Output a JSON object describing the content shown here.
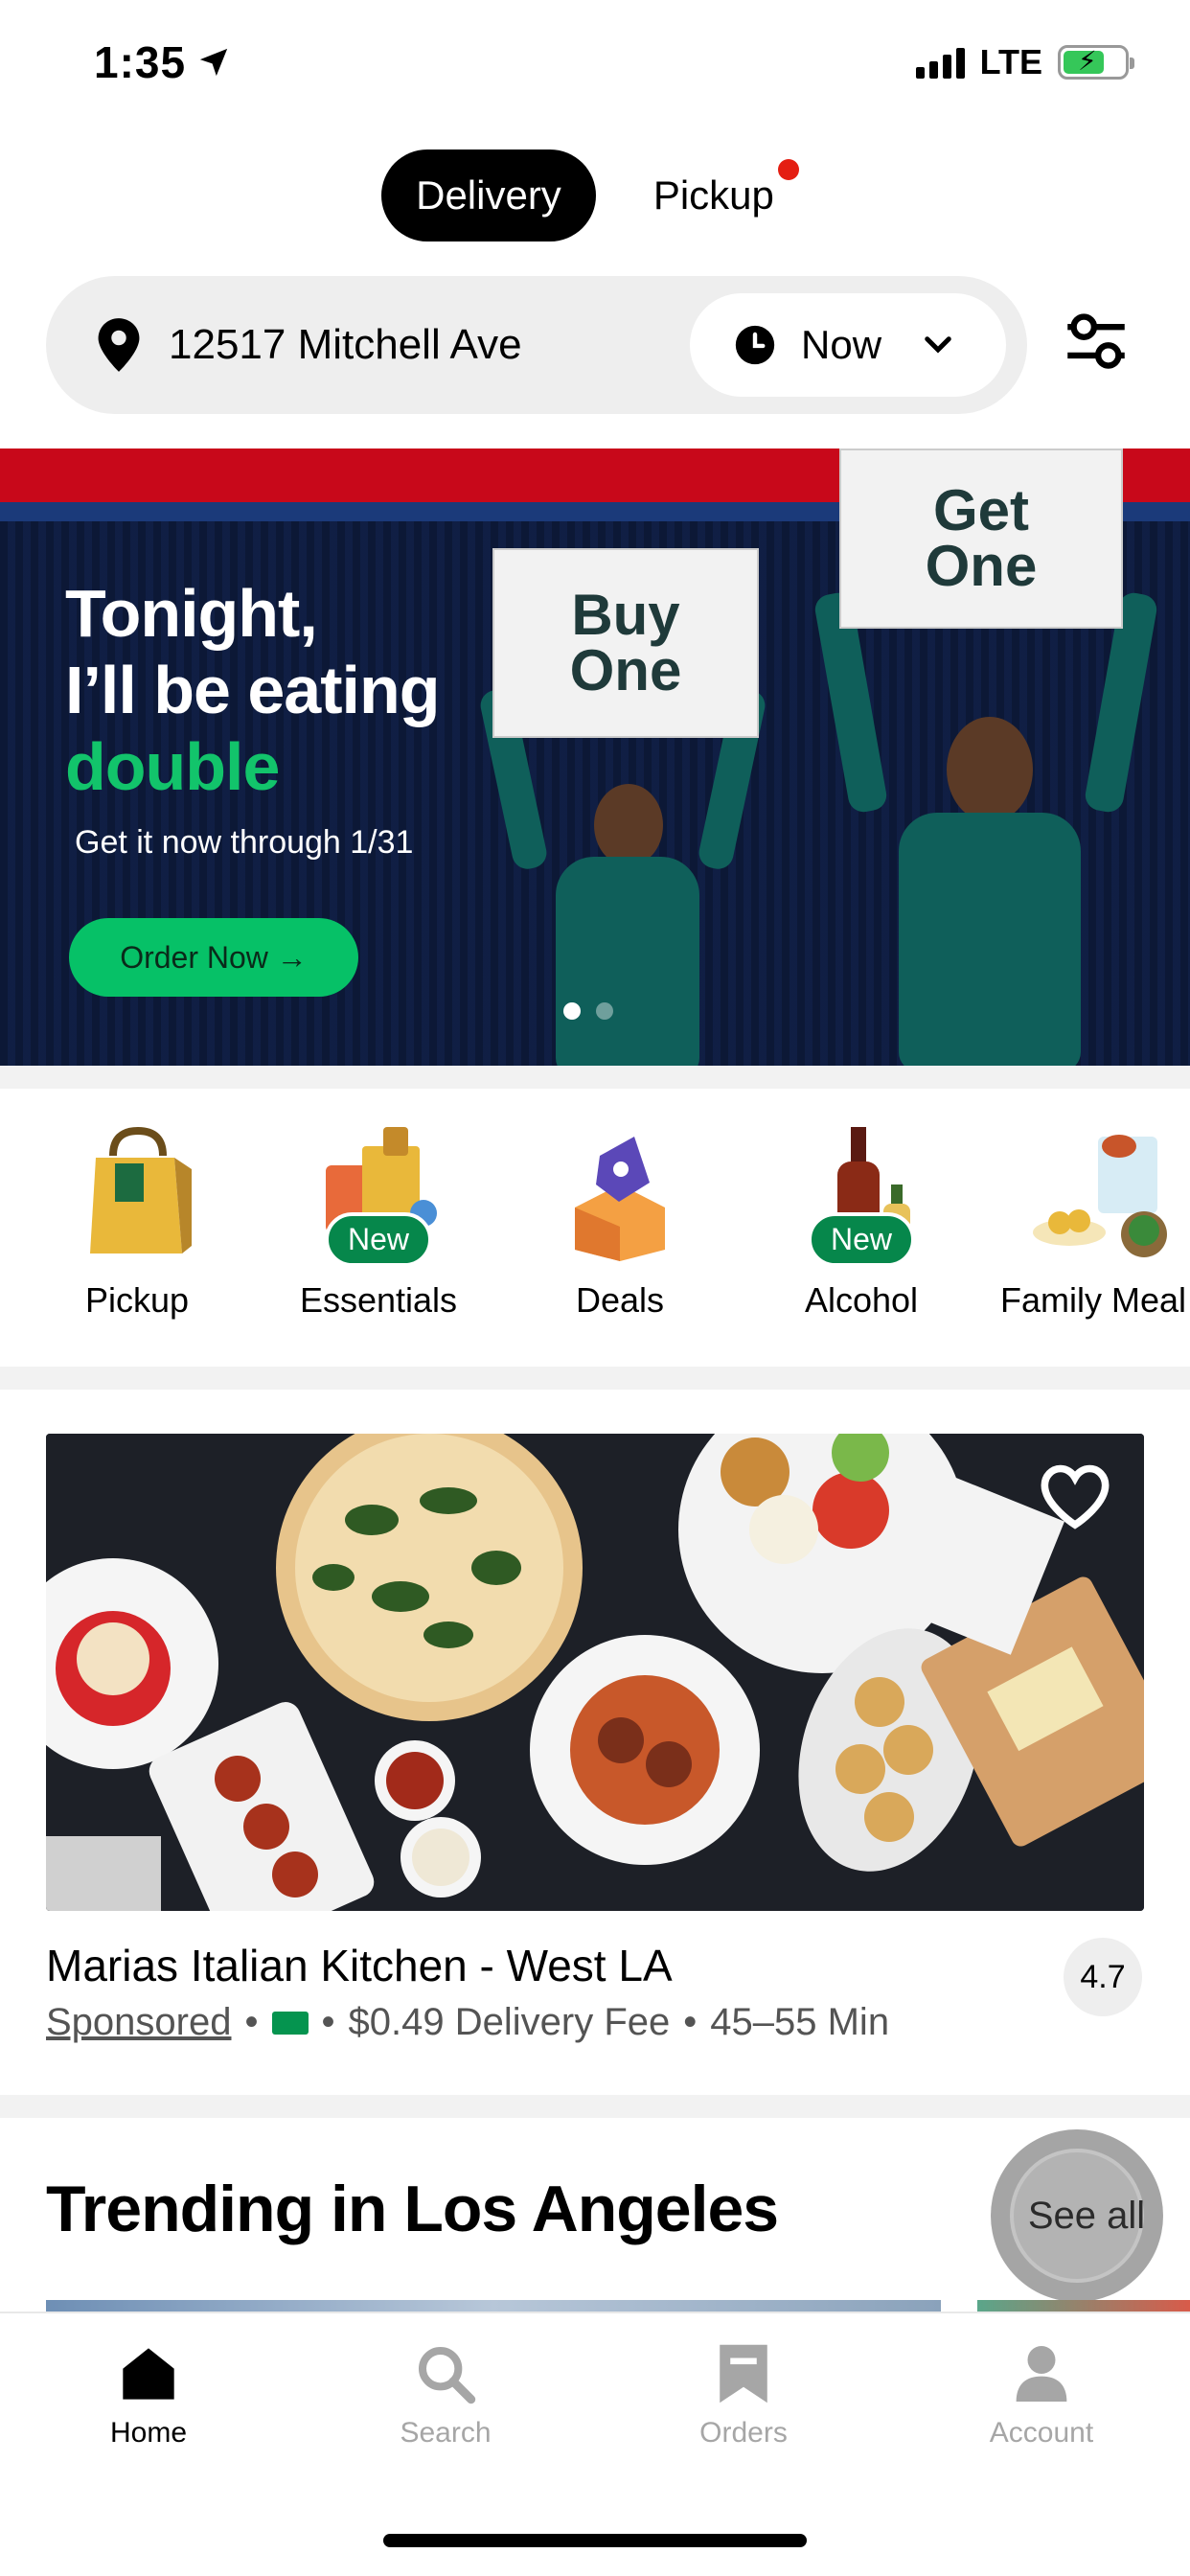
{
  "status_bar": {
    "time": "1:35",
    "network": "LTE"
  },
  "mode_toggle": {
    "delivery": "Delivery",
    "pickup": "Pickup"
  },
  "address": {
    "text": "12517 Mitchell Ave",
    "time": "Now"
  },
  "banner": {
    "line1": "Tonight,",
    "line2": "I’ll be eating",
    "line3": "double",
    "subtitle": "Get it now through 1/31",
    "cta": "Order Now →",
    "sign_left": "Buy One",
    "sign_right": "Get One"
  },
  "categories": [
    {
      "label": "Pickup"
    },
    {
      "label": "Essentials",
      "badge": "New"
    },
    {
      "label": "Deals"
    },
    {
      "label": "Alcohol",
      "badge": "New"
    },
    {
      "label": "Family Meal"
    }
  ],
  "restaurant": {
    "name": "Marias Italian Kitchen - West LA",
    "sponsored": "Sponsored",
    "fee": "$0.49 Delivery Fee",
    "time": "45–55 Min",
    "rating": "4.7",
    "separator": "•"
  },
  "trending": {
    "title": "Trending in Los Angeles",
    "see_all": "See all"
  },
  "tab_bar": [
    {
      "label": "Home",
      "icon": "home-icon",
      "active": true
    },
    {
      "label": "Search",
      "icon": "search-icon",
      "active": false
    },
    {
      "label": "Orders",
      "icon": "receipt-icon",
      "active": false
    },
    {
      "label": "Account",
      "icon": "person-icon",
      "active": false
    }
  ],
  "colors": {
    "accent_green": "#06c167",
    "badge_green": "#06874b",
    "notification_red": "#e41e12",
    "banner_navy": "#0e1b3a"
  }
}
